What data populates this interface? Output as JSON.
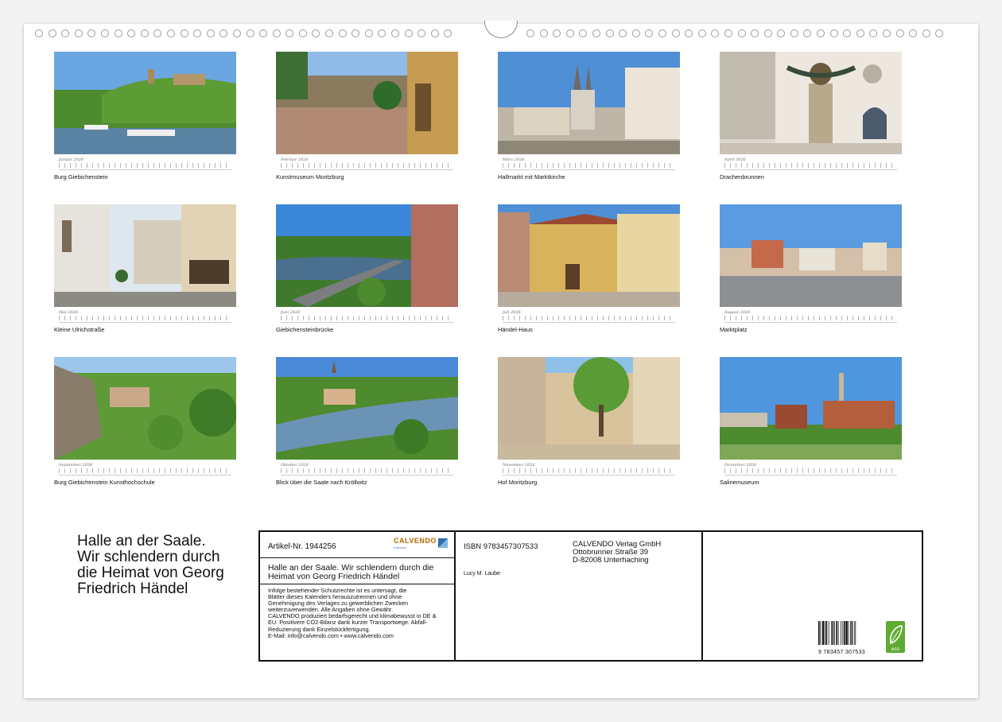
{
  "document": {
    "title": "Halle an der Saale. Wir schlendern durch die Heimat von Georg Friedrich Händel",
    "title_lines": [
      "Halle an der Saale.",
      "Wir schlendern durch",
      "die Heimat von Georg",
      "Friedrich Händel"
    ]
  },
  "months": [
    {
      "name": "Januar 2026",
      "caption": "Burg Giebichenstein",
      "scene": "castle-river"
    },
    {
      "name": "Februar 2026",
      "caption": "Kunstmuseum Moritzburg",
      "scene": "museum-court"
    },
    {
      "name": "März 2026",
      "caption": "Hallmarkt mit Marktkirche",
      "scene": "church-towers"
    },
    {
      "name": "April 2026",
      "caption": "Drachenbrunnen",
      "scene": "dragon-fountain"
    },
    {
      "name": "Mai 2026",
      "caption": "Kleine Ulrichstraße",
      "scene": "old-street"
    },
    {
      "name": "Juni 2026",
      "caption": "Giebichensteinbrücke",
      "scene": "bridge-river"
    },
    {
      "name": "Juli 2026",
      "caption": "Händel-Haus",
      "scene": "handel-house"
    },
    {
      "name": "August 2026",
      "caption": "Marktplatz",
      "scene": "market-square"
    },
    {
      "name": "September 2026",
      "caption": "Burg Giebichenstein Kunsthochschule",
      "scene": "green-rocks"
    },
    {
      "name": "Oktober 2026",
      "caption": "Blick über die Saale nach Kröllwitz",
      "scene": "river-view"
    },
    {
      "name": "November 2026",
      "caption": "Hof Moritzburg",
      "scene": "courtyard-tree"
    },
    {
      "name": "Dezember 2026",
      "caption": "Salinemuseum",
      "scene": "saline-museum"
    }
  ],
  "info": {
    "article_number": "Artikel-Nr. 1944256",
    "logo": "CALVENDO",
    "logo_sub": "Kalender",
    "title": "Halle an der Saale. Wir schlendern durch die Heimat von Georg Friedrich Händel",
    "legal_lines": [
      "Infolge bestehender Schutzrechte ist es untersagt, die",
      "Blätter dieses Kalenders herauszutrennen und ohne",
      "Genehmigung des Verlages zu gewerblichen Zwecken",
      "weiterzuverwenden. Alle Angaben ohne Gewähr.",
      "CALVENDO produziert bedarfsgerecht und klimabewusst in DE &",
      "EU. Positivere CO2-Bilanz dank kurzer Transportwege. Abfall-",
      "Reduzierung dank Einzelstückfertigung.",
      "E-Mail: info@calvendo.com • www.calvendo.com"
    ],
    "isbn": "ISBN 9783457307533",
    "author": "Lucy M. Laube",
    "publisher_lines": [
      "CALVENDO Verlag GmbH",
      "Ottobrunner Straße 39",
      "D-82008 Unterhaching"
    ],
    "barcode_number": "9 783457 307533",
    "eco_label": "eco"
  },
  "colors": {
    "sky": "#4f8fd6",
    "green": "#4e8a2e",
    "sandstone": "#c9a26a",
    "border": "#111111"
  }
}
